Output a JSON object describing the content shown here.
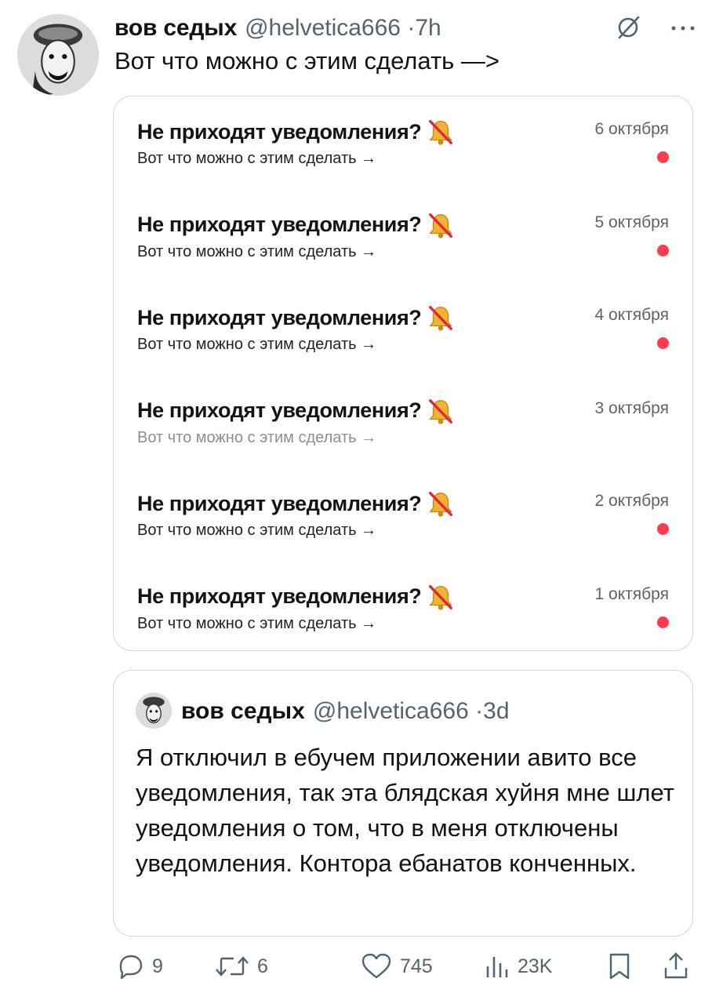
{
  "tweet": {
    "author_name": "вов седых",
    "author_handle": "@helvetica666",
    "separator": "·",
    "time": "7h",
    "text": "Вот что можно с этим сделать —>",
    "icons": [
      "grok-icon",
      "more-icon"
    ]
  },
  "notifications": [
    {
      "title": "Не приходят уведомления?",
      "subtitle": "Вот что можно с этим сделать →",
      "date": "6 октября",
      "unread": true,
      "faded": false
    },
    {
      "title": "Не приходят уведомления?",
      "subtitle": "Вот что можно с этим сделать →",
      "date": "5 октября",
      "unread": true,
      "faded": false
    },
    {
      "title": "Не приходят уведомления?",
      "subtitle": "Вот что можно с этим сделать →",
      "date": "4 октября",
      "unread": true,
      "faded": false
    },
    {
      "title": "Не приходят уведомления?",
      "subtitle": "Вот что можно с этим сделать →",
      "date": "3 октября",
      "unread": false,
      "faded": true
    },
    {
      "title": "Не приходят уведомления?",
      "subtitle": "Вот что можно с этим сделать →",
      "date": "2 октября",
      "unread": true,
      "faded": false
    },
    {
      "title": "Не приходят уведомления?",
      "subtitle": "Вот что можно с этим сделать →",
      "date": "1 октября",
      "unread": true,
      "faded": false
    }
  ],
  "quote": {
    "author_name": "вов седых",
    "author_handle": "@helvetica666",
    "separator": "·",
    "time": "3d",
    "text": "Я отключил в ебучем приложении авито все уведомления, так эта блядская хуйня мне шлет уведомления о том, что в меня отключены уведомления. Контора ебанатов конченных."
  },
  "actions": {
    "replies": "9",
    "retweets": "6",
    "likes": "745",
    "views": "23K"
  },
  "colors": {
    "unread_dot": "#ff3b4e",
    "secondary_text": "#536471",
    "border": "#cfd9de"
  }
}
